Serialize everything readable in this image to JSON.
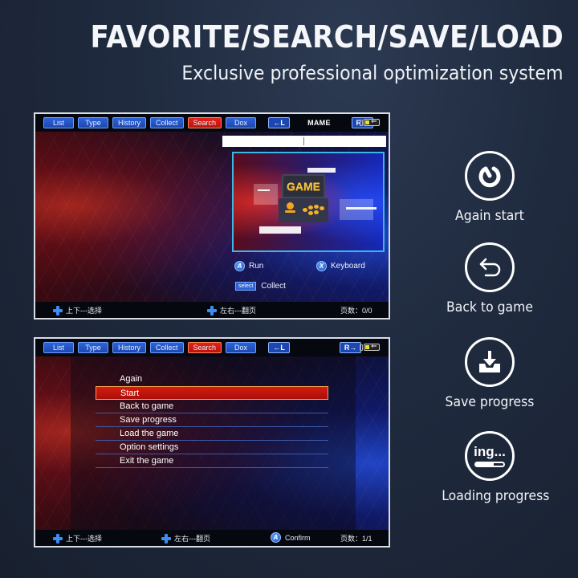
{
  "header": {
    "title": "FAVORITE/SEARCH/SAVE/LOAD",
    "subtitle": "Exclusive professional optimization system"
  },
  "screen1": {
    "tabs": [
      {
        "label": "List",
        "active": false
      },
      {
        "label": "Type",
        "active": false
      },
      {
        "label": "History",
        "active": false
      },
      {
        "label": "Collect",
        "active": false
      },
      {
        "label": "Search",
        "active": true
      },
      {
        "label": "Dox",
        "active": false
      }
    ],
    "left_shoulder": "←L",
    "system_title": "MAME",
    "right_shoulder": "R→",
    "search_value": "",
    "preview_text": "GAME",
    "hints": {
      "run_button": "A",
      "run_label": "Run",
      "keyboard_button": "X",
      "keyboard_label": "Keyboard",
      "select_chip": "select",
      "collect_label": "Collect"
    },
    "footer": {
      "updown": "上下---选择",
      "leftright": "左右---翻页",
      "pages": "页数：0/0"
    }
  },
  "screen2": {
    "tabs": [
      {
        "label": "List",
        "active": false
      },
      {
        "label": "Type",
        "active": false
      },
      {
        "label": "History",
        "active": false
      },
      {
        "label": "Collect",
        "active": false
      },
      {
        "label": "Search",
        "active": true
      },
      {
        "label": "Dox",
        "active": false
      }
    ],
    "left_shoulder": "←L",
    "right_shoulder": "R→",
    "menu": [
      {
        "label": "Again",
        "selected": false
      },
      {
        "label": "Start",
        "selected": true
      },
      {
        "label": "Back to game",
        "selected": false
      },
      {
        "label": "Save progress",
        "selected": false
      },
      {
        "label": "Load the game",
        "selected": false
      },
      {
        "label": "Option settings",
        "selected": false
      },
      {
        "label": "Exit the game",
        "selected": false
      }
    ],
    "footer": {
      "updown": "上下---选择",
      "leftright": "左右---翻页",
      "confirm_button": "A",
      "confirm_label": "Confirm",
      "pages": "页数：1/1"
    }
  },
  "features": [
    {
      "icon": "restart-icon",
      "label": "Again start"
    },
    {
      "icon": "back-arrow-icon",
      "label": "Back to game"
    },
    {
      "icon": "download-tray-icon",
      "label": "Save progress"
    },
    {
      "icon": "loading-icon",
      "label": "Loading progress",
      "icon_text": "ing..."
    }
  ],
  "colors": {
    "tab_blue": "#1d47b0",
    "tab_active_red": "#d51c10",
    "preview_border": "#39b7e6",
    "battery_yellow": "#e8e02a"
  }
}
